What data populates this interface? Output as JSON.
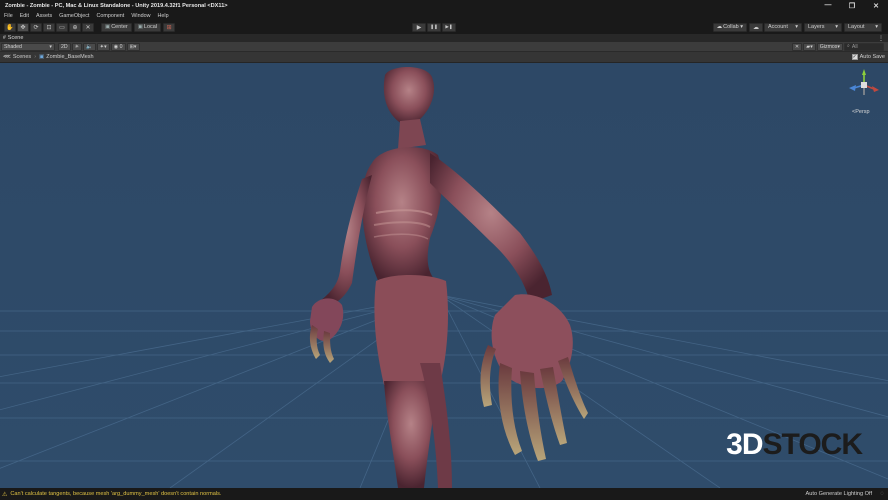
{
  "window": {
    "title": "Zombie - Zombie - PC, Mac & Linux Standalone - Unity 2019.4.32f1 Personal <DX11>",
    "minimize": "—",
    "maximize": "❐",
    "close": "✕"
  },
  "menu": [
    "File",
    "Edit",
    "Assets",
    "GameObject",
    "Component",
    "Window",
    "Help"
  ],
  "toolbar": {
    "pivot_label": "Center",
    "space_label": "Local",
    "collab_label": "Collab ▾",
    "account_label": "Account",
    "layers_label": "Layers",
    "layout_label": "Layout",
    "play": "▶",
    "pause": "❚❚",
    "step": "▶❚"
  },
  "scene": {
    "tab_label": "Scene",
    "shading_mode": "Shaded",
    "mode_2d": "2D",
    "gizmos_label": "Gizmos",
    "search_placeholder": "All",
    "breadcrumb_root": "Scenes",
    "breadcrumb_item": "Zombie_BaseMesh",
    "auto_save_label": "Auto Save",
    "persp_label": "<Persp"
  },
  "status": {
    "message": "Can't calculate tangents, because mesh 'arg_dummy_mesh' doesn't contain normals.",
    "right_text": "Auto Generate Lighting Off"
  },
  "watermark": {
    "part1": "3D",
    "part2": "STOCK"
  },
  "colors": {
    "viewport_bg": "#2e4a68",
    "grid": "#4c6f92",
    "warning": "#e0c244"
  }
}
